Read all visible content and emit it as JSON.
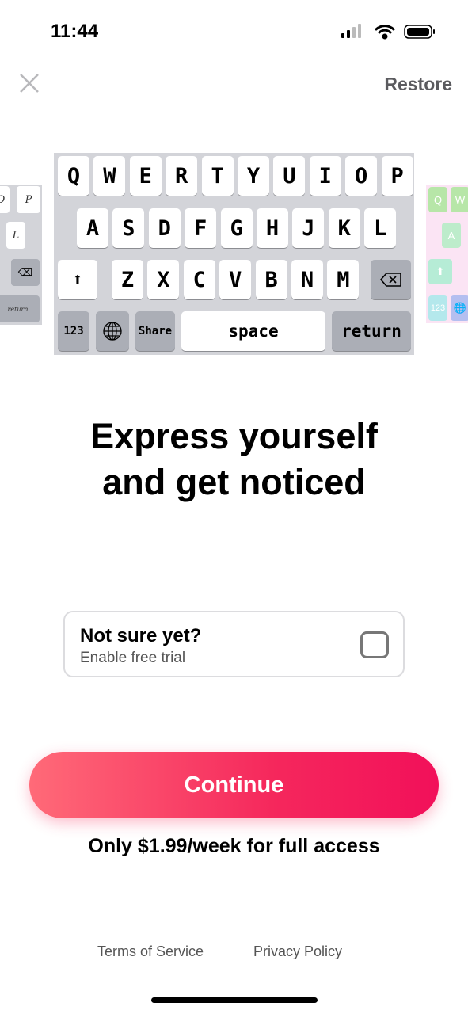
{
  "status": {
    "time": "11:44"
  },
  "header": {
    "close_icon": "close-icon",
    "restore_label": "Restore"
  },
  "keyboard": {
    "row1": [
      "Q",
      "W",
      "E",
      "R",
      "T",
      "Y",
      "U",
      "I",
      "O",
      "P"
    ],
    "row2": [
      "A",
      "S",
      "D",
      "F",
      "G",
      "H",
      "J",
      "K",
      "L"
    ],
    "row3": [
      "Z",
      "X",
      "C",
      "V",
      "B",
      "N",
      "M"
    ],
    "numbers": "123",
    "share": "Share",
    "space": "space",
    "return": "return",
    "left_preview": {
      "keys": [
        "O",
        "P",
        "L"
      ],
      "return": "return"
    },
    "right_preview": {
      "keys": [
        "Q",
        "W",
        "A"
      ],
      "numbers": "123"
    }
  },
  "headline": {
    "line1": "Express yourself",
    "line2": "and get noticed"
  },
  "trial": {
    "title": "Not sure yet?",
    "subtitle": "Enable free trial",
    "checked": false
  },
  "continue_label": "Continue",
  "price_text": "Only $1.99/week for full access",
  "footer": {
    "terms": "Terms of Service",
    "privacy": "Privacy Policy"
  },
  "colors": {
    "accent_start": "#ff6a78",
    "accent_end": "#f2105a"
  }
}
